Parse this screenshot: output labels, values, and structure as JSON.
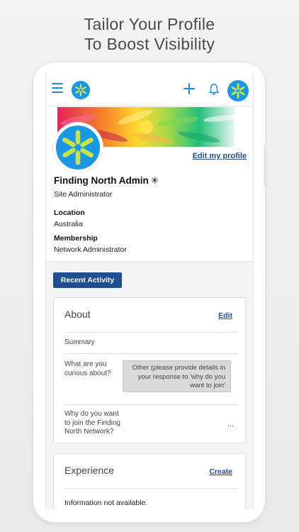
{
  "promo": {
    "line1": "Tailor Your Profile",
    "line2": "To Boost Visibility"
  },
  "topbar": {
    "menu_icon": "hamburger-menu-icon",
    "logo_icon": "spark-logo-icon",
    "add_icon": "plus-icon",
    "notification_icon": "bell-icon",
    "avatar_icon": "spark-avatar-icon"
  },
  "profile": {
    "edit_label": "Edit my profile",
    "name": "Finding North Admin",
    "name_badge": "✳",
    "role": "Site Administrator",
    "location_label": "Location",
    "location_value": "Australia",
    "membership_label": "Membership",
    "membership_value": "Network Administrator"
  },
  "recent_activity_label": "Recent Activity",
  "about": {
    "title": "About",
    "edit_label": "Edit",
    "summary_label": "Summary",
    "curious_label_1": "What are you",
    "curious_label_2": "curious about?",
    "curious_value_1": "Other (please provide details in",
    "curious_value_2": "your response to 'why do you",
    "curious_value_3": "want to join'",
    "join_label_1": "Why do you want",
    "join_label_2": "to join the Finding",
    "join_label_3": "North Network?",
    "join_value": "..."
  },
  "experience": {
    "title": "Experience",
    "create_label": "Create",
    "empty_text": "Information not available."
  },
  "colors": {
    "brand_blue": "#1b97e3",
    "logo_yellow": "#c7e34a",
    "link_navy": "#1f4e91"
  }
}
